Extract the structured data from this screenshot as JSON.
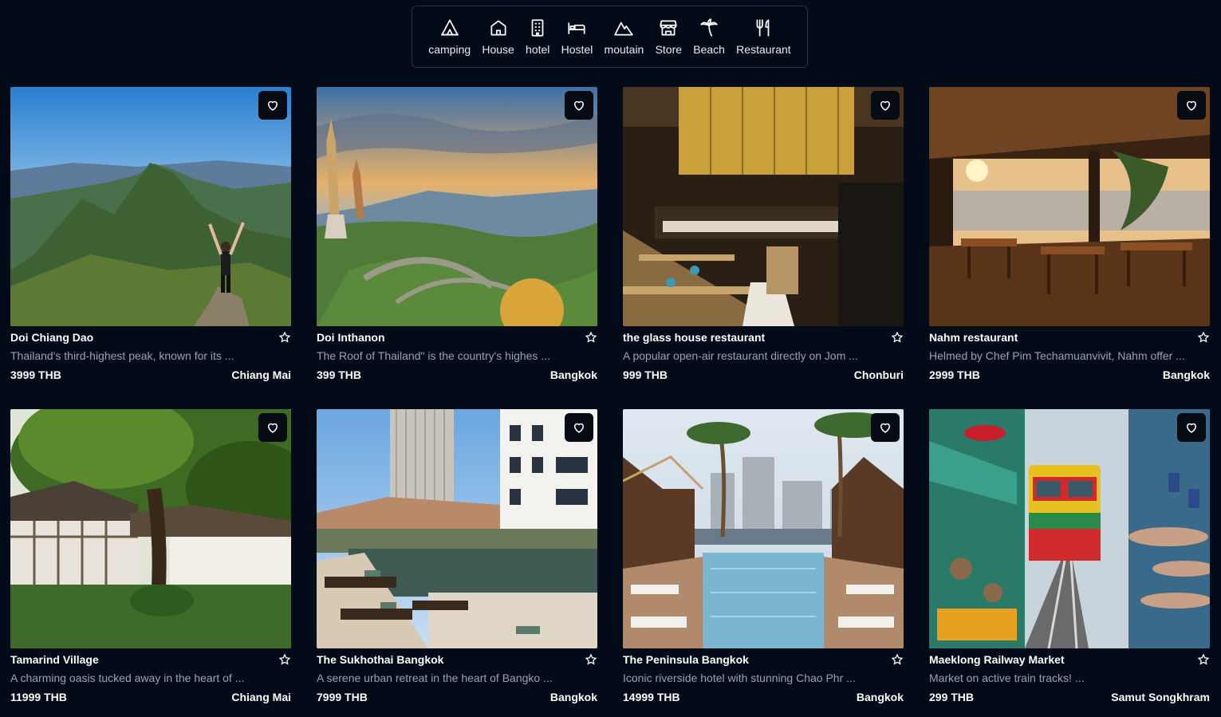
{
  "categories": [
    {
      "label": "camping",
      "icon": "tent-icon"
    },
    {
      "label": "House",
      "icon": "house-icon"
    },
    {
      "label": "hotel",
      "icon": "hotel-building-icon"
    },
    {
      "label": "Hostel",
      "icon": "bed-icon"
    },
    {
      "label": "moutain",
      "icon": "mountain-icon"
    },
    {
      "label": "Store",
      "icon": "store-icon"
    },
    {
      "label": "Beach",
      "icon": "palm-tree-icon"
    },
    {
      "label": "Restaurant",
      "icon": "utensils-icon"
    }
  ],
  "listings": [
    {
      "title": "Doi Chiang Dao",
      "description": "Thailand's third-highest peak, known for its ...",
      "price": "3999 THB",
      "location": "Chiang Mai",
      "photo": "mountain-hiker-photo"
    },
    {
      "title": "Doi Inthanon",
      "description": "The Roof of Thailand\" is the country's highes ...",
      "price": "399 THB",
      "location": "Bangkok",
      "photo": "pagoda-garden-photo"
    },
    {
      "title": "the glass house restaurant",
      "description": "A popular open-air restaurant directly on Jom ...",
      "price": "999 THB",
      "location": "Chonburi",
      "photo": "buffet-restaurant-photo"
    },
    {
      "title": "Nahm restaurant",
      "description": "Helmed by Chef Pim Techamuanvivit, Nahm offer ...",
      "price": "2999 THB",
      "location": "Bangkok",
      "photo": "seaside-dining-photo"
    },
    {
      "title": "Tamarind Village",
      "description": "A charming oasis tucked away in the heart of ...",
      "price": "11999 THB",
      "location": "Chiang Mai",
      "photo": "tree-courtyard-photo"
    },
    {
      "title": "The Sukhothai Bangkok",
      "description": "A serene urban retreat in the heart of Bangko ...",
      "price": "7999 THB",
      "location": "Bangkok",
      "photo": "hotel-pool-photo"
    },
    {
      "title": "The Peninsula Bangkok",
      "description": "Iconic riverside hotel with stunning Chao Phr ...",
      "price": "14999 THB",
      "location": "Bangkok",
      "photo": "riverside-pool-photo"
    },
    {
      "title": "Maeklong Railway Market",
      "description": "Market on active train tracks! ...",
      "price": "299 THB",
      "location": "Samut Songkhram",
      "photo": "railway-market-photo"
    }
  ],
  "colors": {
    "background": "#030b18",
    "muted_text": "#9aa2ae",
    "border": "#2a3140"
  }
}
